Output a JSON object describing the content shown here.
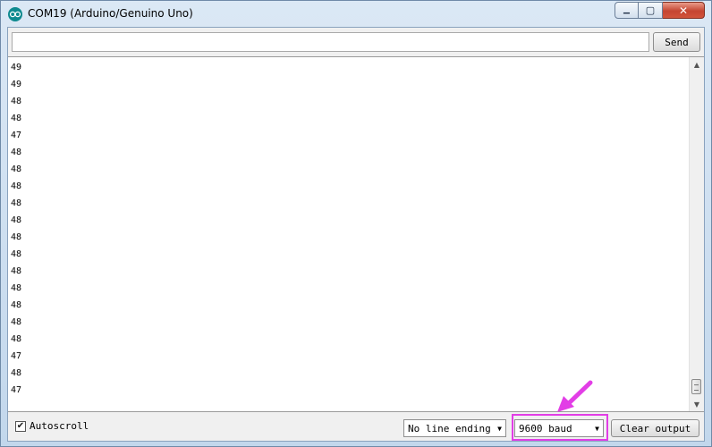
{
  "window": {
    "title": "COM19 (Arduino/Genuino Uno)"
  },
  "caption": {
    "minimize": "▁",
    "maximize": "▢",
    "close": "✕"
  },
  "input": {
    "value": "",
    "placeholder": ""
  },
  "send_label": "Send",
  "output_lines": [
    "49",
    "49",
    "48",
    "48",
    "47",
    "48",
    "48",
    "48",
    "48",
    "48",
    "48",
    "48",
    "48",
    "48",
    "48",
    "48",
    "48",
    "47",
    "48",
    "47"
  ],
  "autoscroll": {
    "label": "Autoscroll",
    "checked": true
  },
  "line_ending": {
    "selected": "No line ending"
  },
  "baud": {
    "selected": "9600 baud"
  },
  "clear_label": "Clear output",
  "colors": {
    "highlight": "#e23ee6",
    "accent_icon": "#0f8a8f"
  },
  "icons": {
    "app": "arduino-logo-icon",
    "dropdown": "chevron-down-icon",
    "check": "check-icon"
  }
}
